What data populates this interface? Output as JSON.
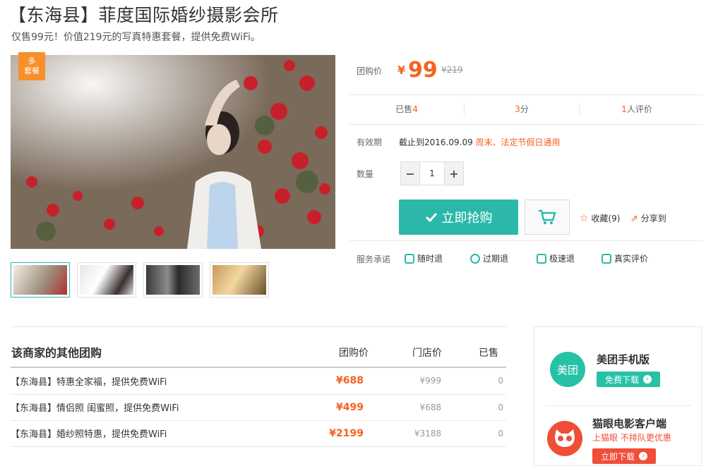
{
  "header": {
    "title": "【东海县】菲度国际婚纱摄影会所",
    "subtitle": "仅售99元！价值219元的写真特惠套餐，提供免费WiFi。"
  },
  "gallery": {
    "badge_line1": "多",
    "badge_line2": "套餐",
    "thumbnails": [
      "thumb-1",
      "thumb-2",
      "thumb-3",
      "thumb-4"
    ]
  },
  "deal": {
    "price_label": "团购价",
    "currency": "¥",
    "price": "99",
    "original_price": "¥219",
    "sold_label": "已售",
    "sold_count": "4",
    "score": "3",
    "score_unit": "分",
    "reviews_count": "1",
    "reviews_label": "人评价",
    "validity_label": "有效期",
    "validity_value": "截止到2016.09.09",
    "validity_note": "周末、法定节假日通用",
    "quantity_label": "数量",
    "quantity_value": "1",
    "minus": "−",
    "plus": "+",
    "buy_label": "立即抢购",
    "favorite_label": "收藏",
    "favorite_count": "(9)",
    "share_label": "分享到"
  },
  "services": {
    "label": "服务承诺",
    "items": [
      "随时退",
      "过期退",
      "极速退",
      "真实评价"
    ]
  },
  "others": {
    "title": "该商家的其他团购",
    "col_group_price": "团购价",
    "col_store_price": "门店价",
    "col_sold": "已售",
    "rows": [
      {
        "name": "【东海县】特惠全家福，提供免费WiFi",
        "group_price": "¥688",
        "store_price": "¥999",
        "sold": "0"
      },
      {
        "name": "【东海县】情侣照 闺蜜照，提供免费WiFi",
        "group_price": "¥499",
        "store_price": "¥688",
        "sold": "0"
      },
      {
        "name": "【东海县】婚纱照特惠，提供免费WiFi",
        "group_price": "¥2199",
        "store_price": "¥3188",
        "sold": "0"
      }
    ]
  },
  "sidebar": {
    "meituan_icon_text": "美团",
    "meituan_title": "美团手机版",
    "meituan_button": "免费下载",
    "maoyan_title": "猫眼电影客户端",
    "maoyan_subtitle": "上猫眼 不排队更优惠",
    "maoyan_button": "立即下载"
  },
  "colors": {
    "accent": "#2bb8aa",
    "price": "#f76120",
    "badge": "#f7902a",
    "maoyan": "#f04e37"
  }
}
